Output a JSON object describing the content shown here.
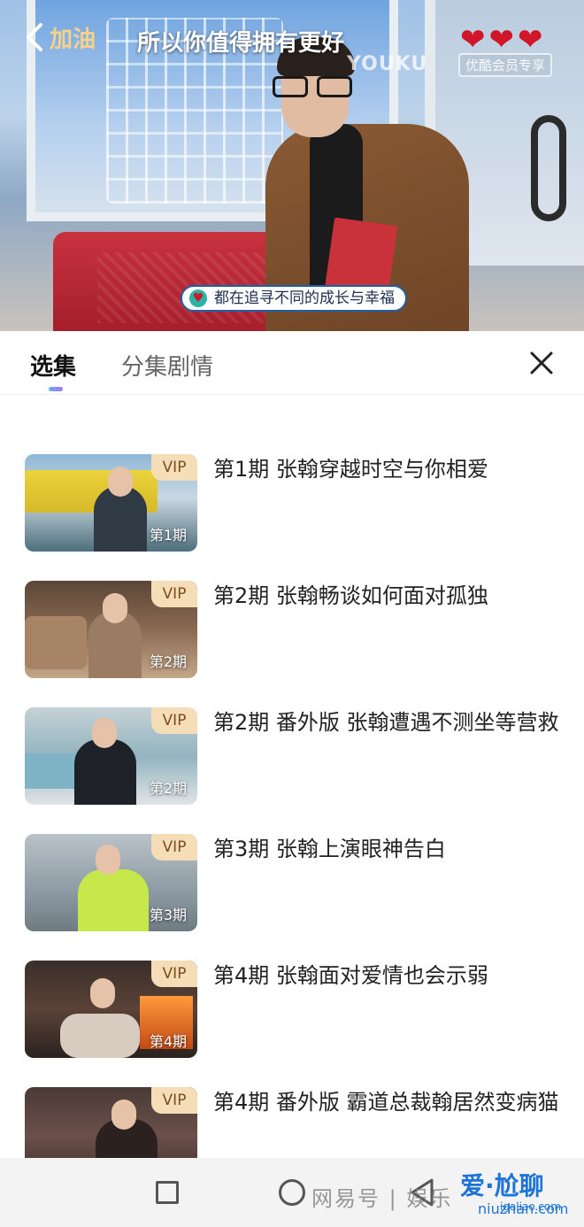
{
  "player": {
    "back_label": "加油",
    "title": "所以你值得拥有更好",
    "hearts": [
      "❤",
      "❤",
      "❤"
    ],
    "logo": "YOUKU",
    "vip_watermark": "优酷会员专享",
    "caption": "都在追寻不同的成长与幸福"
  },
  "tabs": {
    "active": "选集",
    "inactive": "分集剧情"
  },
  "episodes": [
    {
      "vip": "VIP",
      "label": "第1期",
      "title": "第1期 张翰穿越时空与你相爱"
    },
    {
      "vip": "VIP",
      "label": "第2期",
      "title": "第2期 张翰畅谈如何面对孤独"
    },
    {
      "vip": "VIP",
      "label": "第2期",
      "title": "第2期 番外版 张翰遭遇不测坐等营救"
    },
    {
      "vip": "VIP",
      "label": "第3期",
      "title": "第3期 张翰上演眼神告白"
    },
    {
      "vip": "VIP",
      "label": "第4期",
      "title": "第4期 张翰面对爱情也会示弱"
    },
    {
      "vip": "VIP",
      "label": "",
      "title": "第4期 番外版 霸道总裁翰居然变病猫"
    }
  ],
  "watermarks": {
    "netease": "网易号 | 娱乐",
    "site_name": "爱·尬聊",
    "site_url": "igaliao.com",
    "site_url2": "niuzhan.com"
  },
  "colors": {
    "vip_badge_bg": "#f5deb7",
    "vip_badge_text": "#7b4e1f",
    "back_label": "#f4d28b",
    "hearts": "#d2162a"
  }
}
